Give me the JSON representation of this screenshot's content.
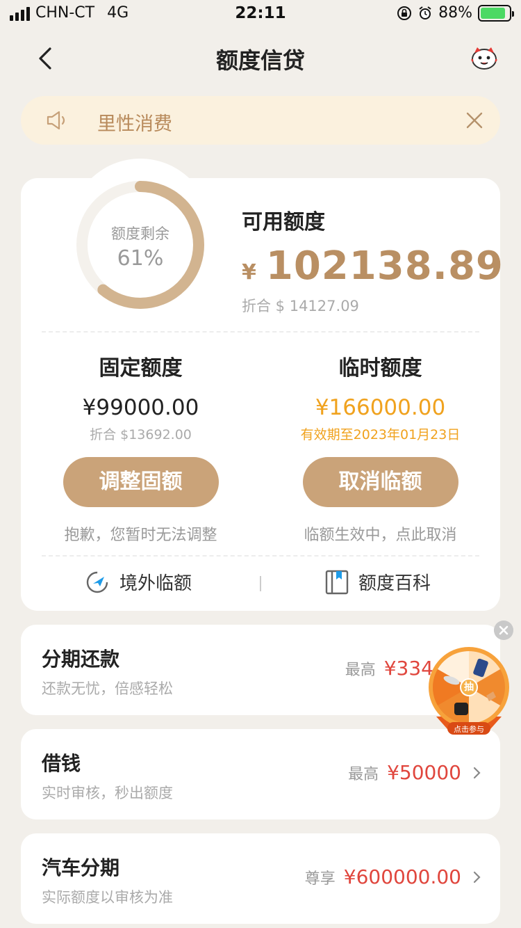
{
  "status_bar": {
    "carrier": "CHN-CT",
    "network": "4G",
    "time": "22:11",
    "battery_pct": "88%",
    "battery_level": 0.88
  },
  "nav": {
    "title": "额度信贷"
  },
  "notice": {
    "text": "里性消费"
  },
  "quota": {
    "ring_label": "额度剩余",
    "ring_value": "61%",
    "ring_fraction": 0.61,
    "available_title": "可用额度",
    "available_currency": "¥",
    "available_amount": "102138.89",
    "available_usd": "折合 $ 14127.09"
  },
  "fixed": {
    "title": "固定额度",
    "amount": "¥99000.00",
    "usd": "折合 $13692.00",
    "button": "调整固额",
    "note": "抱歉，您暂时无法调整"
  },
  "temporary": {
    "title": "临时额度",
    "amount": "¥166000.00",
    "validity": "有效期至2023年01月23日",
    "button": "取消临额",
    "note": "临额生效中，点此取消"
  },
  "links": {
    "overseas": "境外临额",
    "encyclopedia": "额度百科"
  },
  "rows": [
    {
      "title": "分期还款",
      "subtitle": "还款无忧，倍感轻松",
      "prefix": "最高",
      "amount": "¥334"
    },
    {
      "title": "借钱",
      "subtitle": "实时审核，秒出额度",
      "prefix": "最高",
      "amount": "¥50000"
    },
    {
      "title": "汽车分期",
      "subtitle": "实际额度以审核为准",
      "prefix": "尊享",
      "amount": "¥600000.00"
    }
  ],
  "wheel": {
    "center": "抽",
    "label": "点击参与"
  },
  "colors": {
    "accent": "#caa379",
    "amount_gold": "#b98f63",
    "temp_orange": "#f0a21e",
    "red": "#e0463d",
    "background": "#f2efea"
  }
}
